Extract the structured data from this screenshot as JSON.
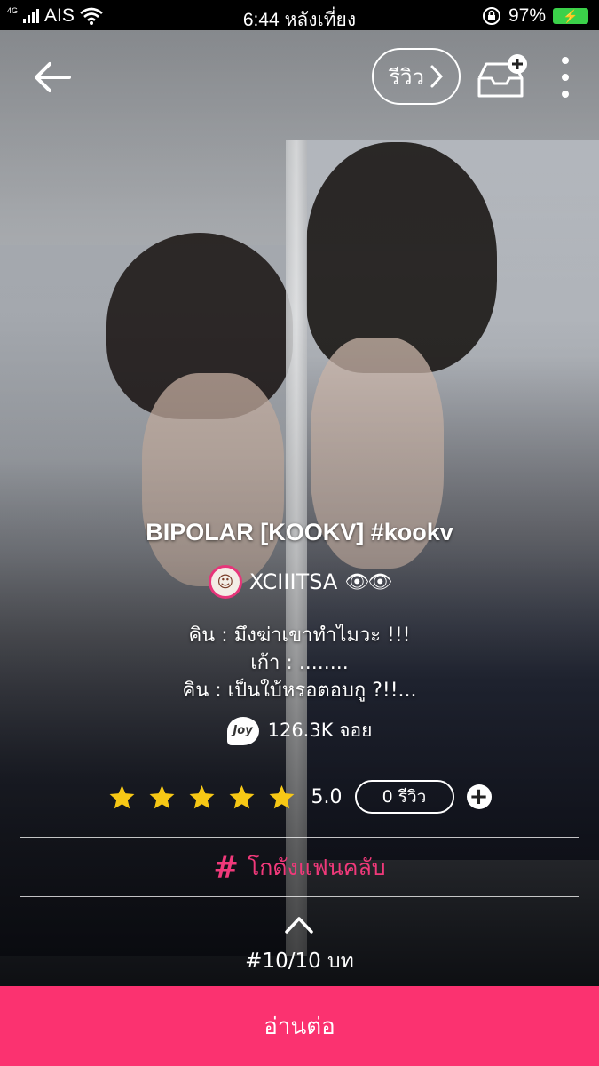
{
  "status_bar": {
    "network": "4G",
    "carrier": "AIS",
    "time": "6:44 หลังเที่ยง",
    "battery": "97%"
  },
  "top_bar": {
    "review_label": "รีวิว"
  },
  "story": {
    "title": "BIPOLAR [KOOKV] #kookv",
    "author": "XCIIITSA",
    "author_emoji": "👁👁",
    "description": [
      "คิน : มึงฆ่าเขาทำไมวะ !!!",
      "เก้า : ........",
      "คิน : เป็นใบ้หรอตอบกู ?!!..."
    ],
    "joy_badge": "Joy",
    "joy_count": "126.3K จอย",
    "rating": "5.0",
    "review_count": "0 รีวิว",
    "fanclub_label": "โกดังแฟนคลับ",
    "chapter_label": "#10/10 บท"
  },
  "read_button_label": "อ่านต่อ",
  "colors": {
    "accent": "#fb3270",
    "fanclub": "#f0397a",
    "star": "#f7c815"
  }
}
